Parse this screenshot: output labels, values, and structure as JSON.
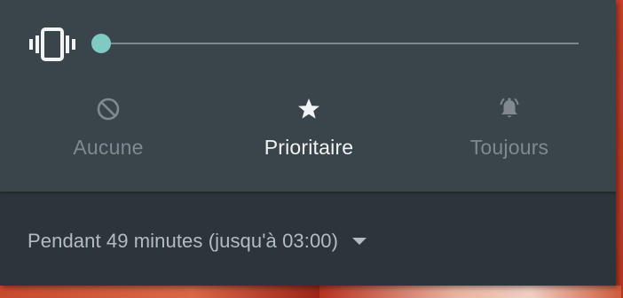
{
  "volume": {
    "icon": "vibrate-icon",
    "level": 0
  },
  "modes": [
    {
      "label": "Aucune",
      "icon": "do-not-disturb-icon",
      "selected": false
    },
    {
      "label": "Prioritaire",
      "icon": "star-icon",
      "selected": true
    },
    {
      "label": "Toujours",
      "icon": "bell-icon",
      "selected": false
    }
  ],
  "duration": {
    "label": "Pendant 49 minutes (jusqu'à 03:00)",
    "icon": "dropdown-arrow-icon"
  },
  "colors": {
    "panel": "#3a444b",
    "panel_dark": "#2b353b",
    "accent": "#7fcbc4",
    "active_text": "#f1f3f4",
    "inactive_text": "#7f898f"
  }
}
